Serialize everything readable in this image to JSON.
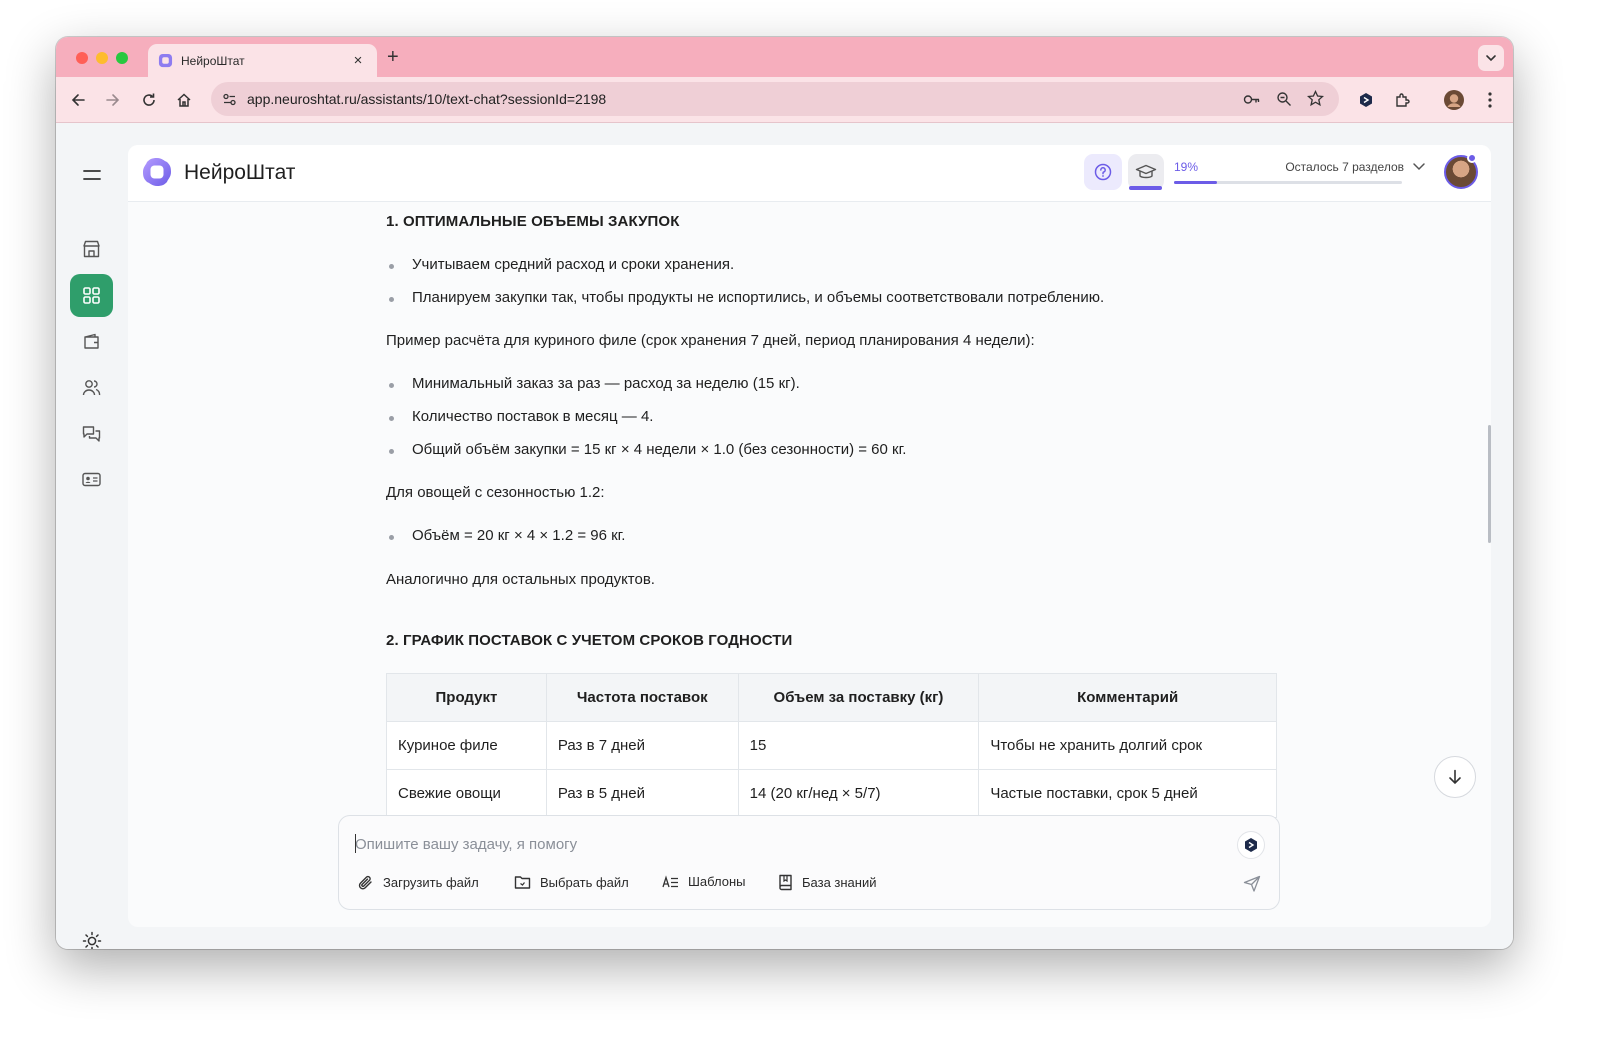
{
  "browser": {
    "tab_title": "НейроШтат",
    "url": "app.neuroshtat.ru/assistants/10/text-chat?sessionId=2198",
    "new_tab_glyph": "+",
    "close_tab_glyph": "×"
  },
  "app": {
    "logo_text": "НейроШтат",
    "accent_color": "#6c5ce7",
    "active_nav_color": "#2f9e6b",
    "progress": {
      "percent_label": "19%",
      "value": 0.19,
      "remaining_label": "Осталось 7 разделов"
    },
    "sidebar": {
      "items": [
        {
          "icon": "menu-icon"
        },
        {
          "icon": "store-icon"
        },
        {
          "icon": "assistants-grid-icon",
          "active": true
        },
        {
          "icon": "wallet-icon"
        },
        {
          "icon": "users-icon"
        },
        {
          "icon": "chats-icon"
        },
        {
          "icon": "id-card-icon"
        },
        {
          "icon": "sun-icon"
        }
      ]
    }
  },
  "message": {
    "section1": {
      "heading": "1. ОПТИМАЛЬНЫЕ ОБЪЕМЫ ЗАКУПОК",
      "bullets": [
        "Учитываем средний расход и сроки хранения.",
        "Планируем закупки так, чтобы продукты не испортились, и объемы соответствовали потреблению."
      ],
      "example_intro": "Пример расчёта для куриного филе (срок хранения 7 дней, период планирования 4 недели):",
      "example_bullets": [
        "Минимальный заказ за раз — расход за неделю (15 кг).",
        "Количество поставок в месяц — 4.",
        "Общий объём закупки = 15 кг × 4 недели × 1.0 (без сезонности) = 60 кг."
      ],
      "veg_intro": "Для овощей с сезонностью 1.2:",
      "veg_bullets": [
        "Объём = 20 кг × 4 × 1.2 = 96 кг."
      ],
      "closing": "Аналогично для остальных продуктов."
    },
    "section2": {
      "heading": "2. ГРАФИК ПОСТАВОК С УЧЕТОМ СРОКОВ ГОДНОСТИ",
      "table": {
        "headers": [
          "Продукт",
          "Частота поставок",
          "Объем за поставку (кг)",
          "Комментарий"
        ],
        "rows": [
          [
            "Куриное филе",
            "Раз в 7 дней",
            "15",
            "Чтобы не хранить долгий срок"
          ],
          [
            "Свежие овощи",
            "Раз в 5 дней",
            "14 (20 кг/нед × 5/7)",
            "Частые поставки, срок 5 дней"
          ]
        ]
      }
    }
  },
  "composer": {
    "placeholder": "Опишите вашу задачу, я помогу",
    "actions": {
      "upload": "Загрузить файл",
      "choose": "Выбрать файл",
      "templates": "Шаблоны",
      "knowledge": "База знаний"
    }
  }
}
